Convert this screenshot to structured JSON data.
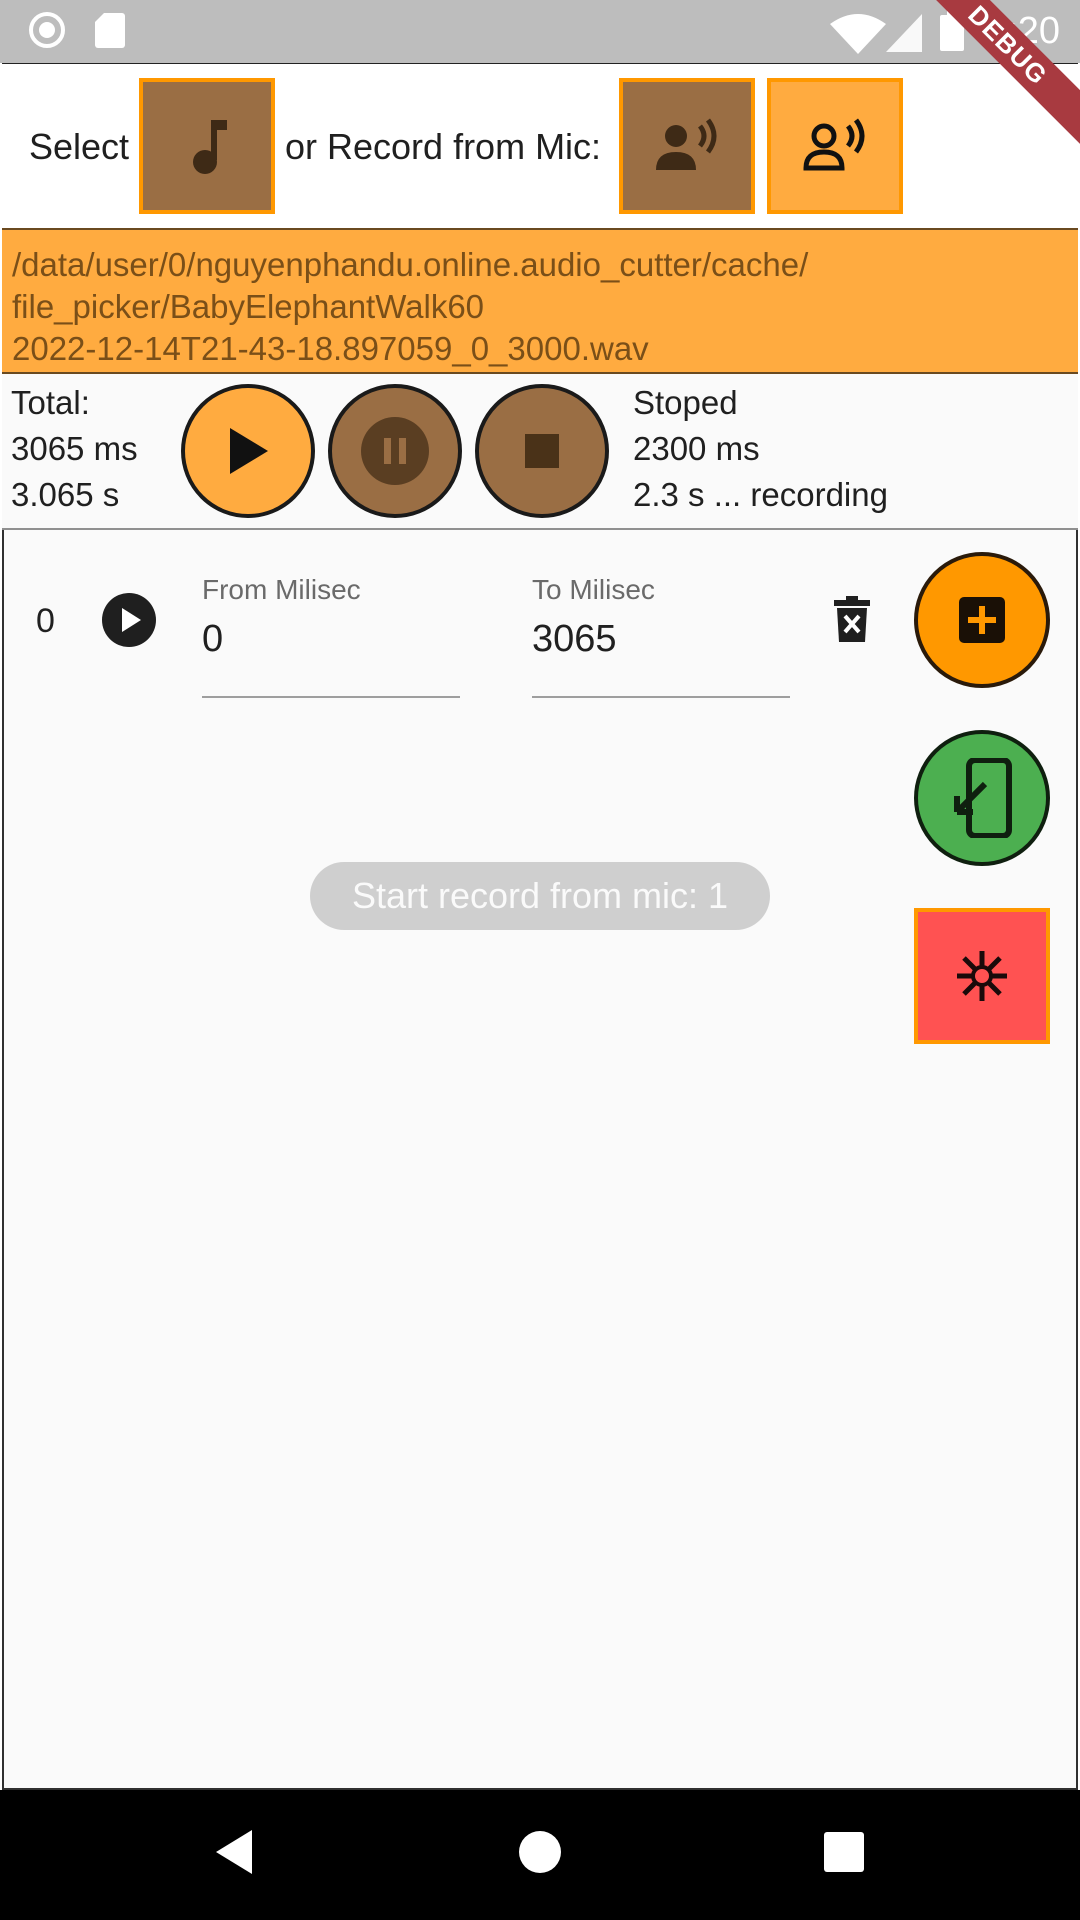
{
  "status_bar": {
    "time": "8:20",
    "icons": [
      "record-circle-icon",
      "sd-card-icon",
      "wifi-icon",
      "signal-icon",
      "battery-icon"
    ]
  },
  "debug_banner": "DEBUG",
  "select_row": {
    "select_label": "Select",
    "record_label": "or Record from Mic:",
    "file_button_icon": "music-note-icon",
    "mic_buttons": [
      "voice-record-icon",
      "voice-record-icon"
    ]
  },
  "file_path": {
    "line1": "/data/user/0/nguyenphandu.online.audio_cutter/cache/",
    "line2": "file_picker/BabyElephantWalk60",
    "line3": "2022-12-14T21-43-18.897059_0_3000.wav"
  },
  "player": {
    "total_label": "Total:",
    "total_ms": "3065 ms",
    "total_s": "3.065 s",
    "status": "Stoped",
    "position_ms": "2300 ms",
    "position_s": "2.3 s ... recording"
  },
  "segment": {
    "index": "0",
    "from_label": "From Milisec",
    "from_value": "0",
    "to_label": "To Milisec",
    "to_value": "3065"
  },
  "toast": "Start record from mic: 1",
  "colors": {
    "accent_orange": "#ffab40",
    "fab_orange": "#ff9800",
    "brown": "#9a6e44",
    "green": "#4caf50",
    "red": "#ff5252"
  }
}
